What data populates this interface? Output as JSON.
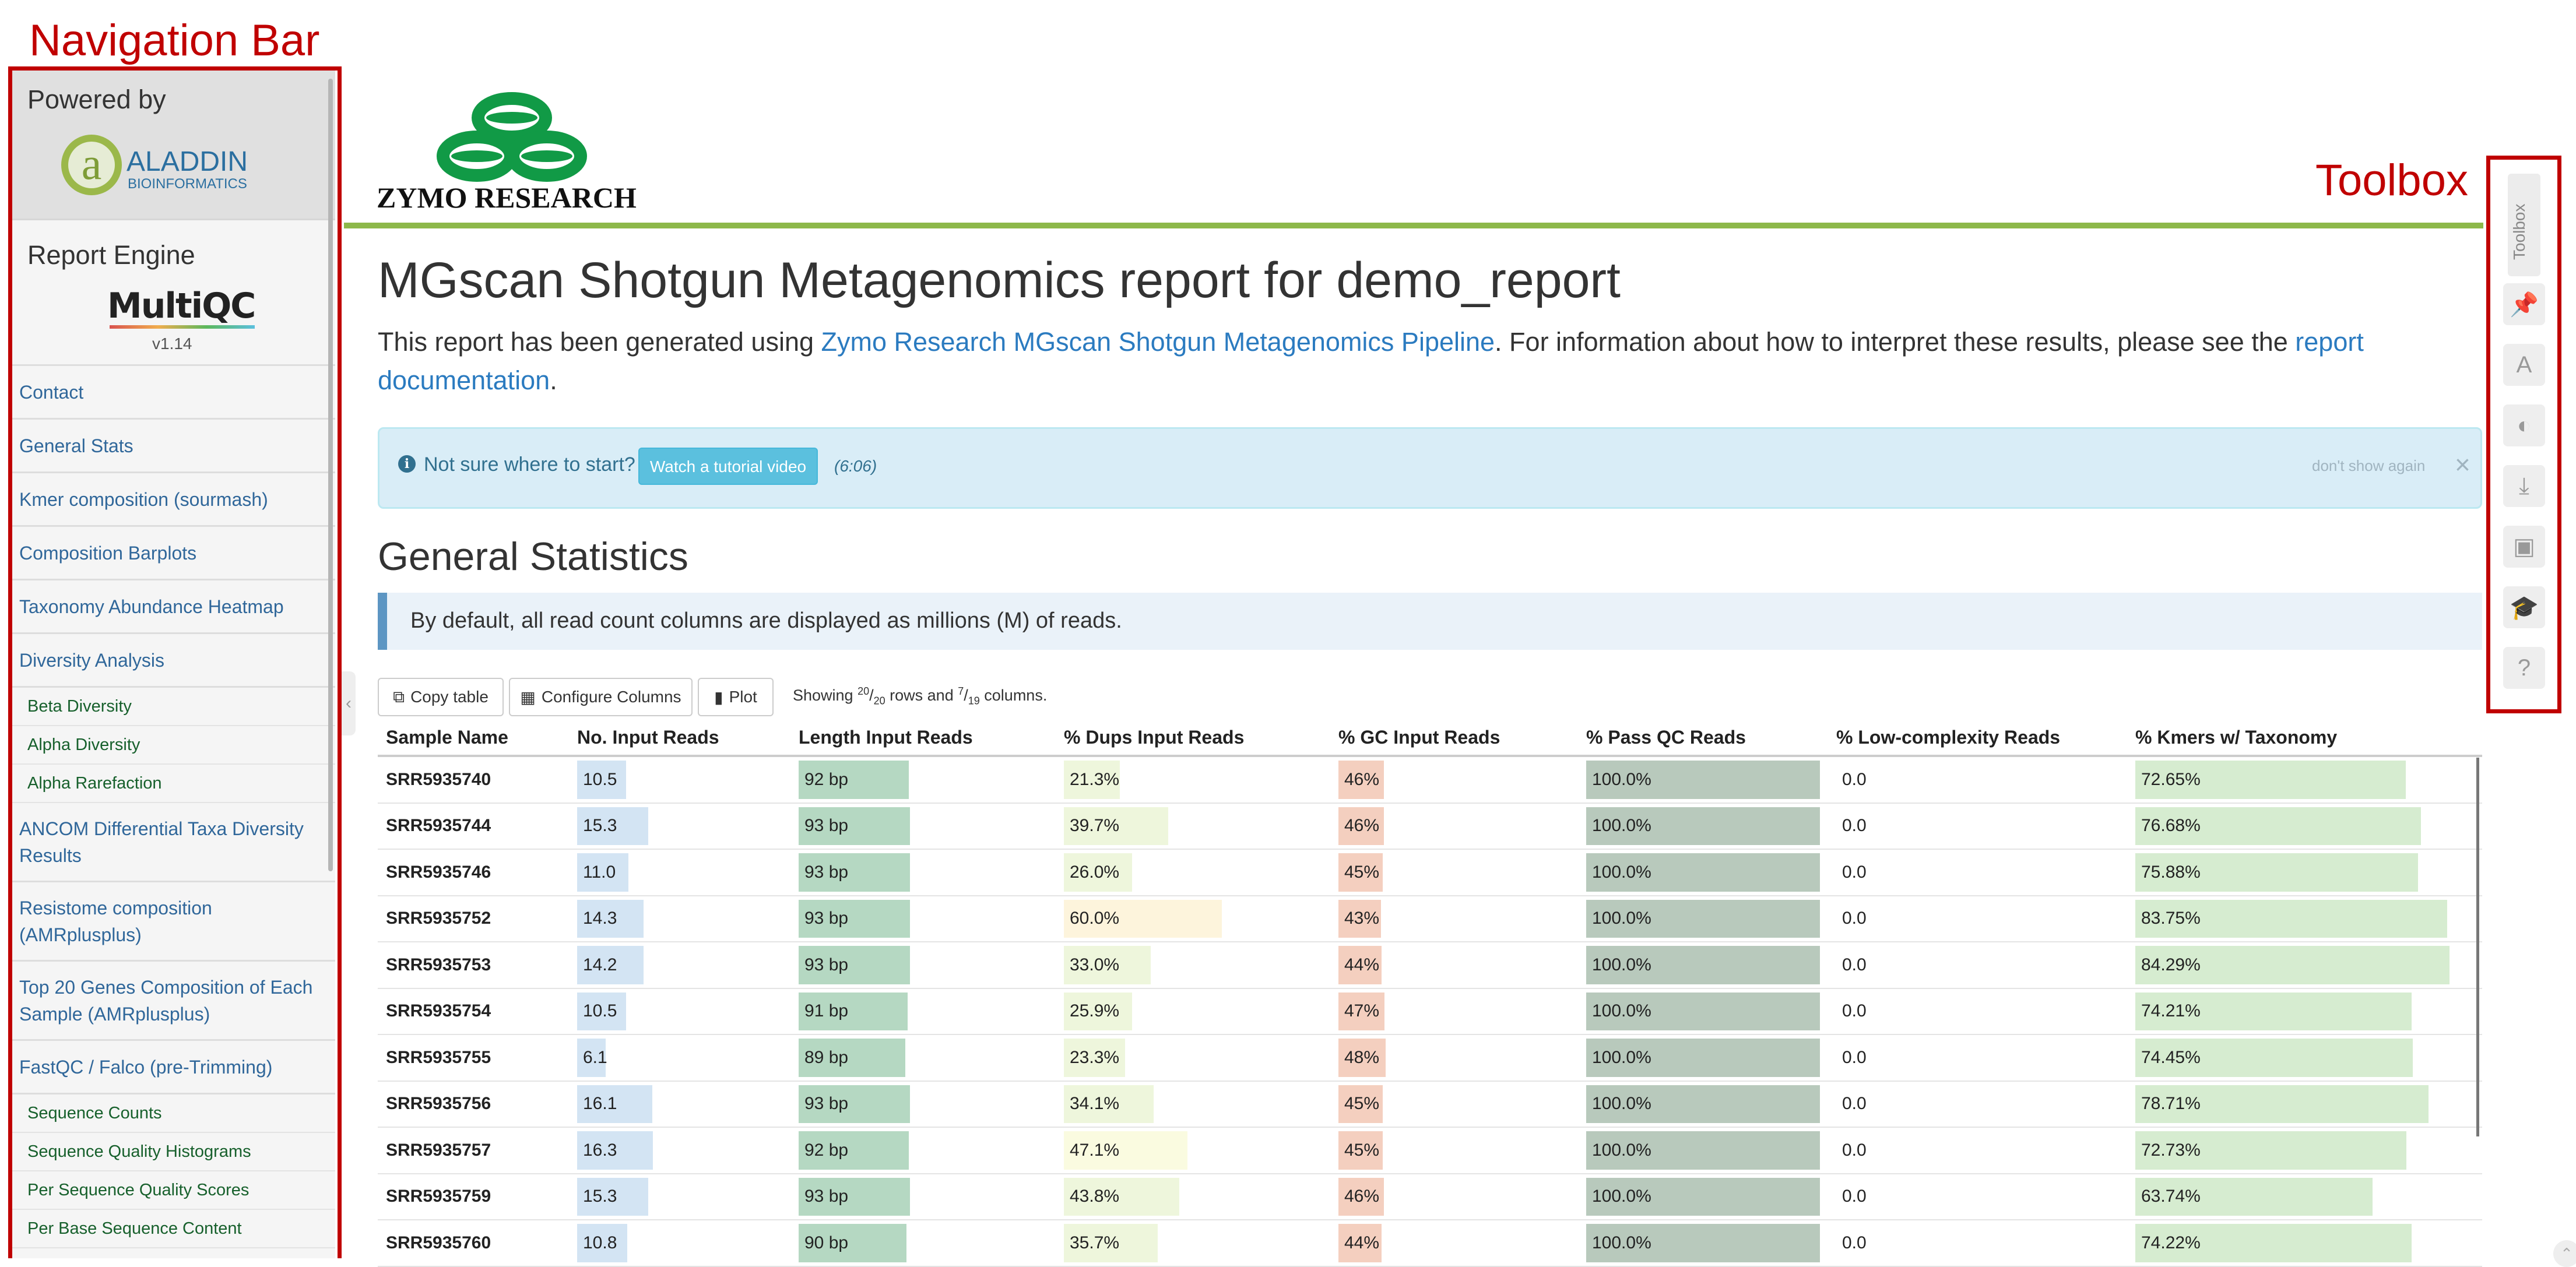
{
  "annotations": {
    "navigation_bar": "Navigation Bar",
    "toolbox": "Toolbox"
  },
  "sidebar": {
    "powered_by": "Powered by",
    "aladdin_name": "ALADDIN",
    "aladdin_sub": "BIOINFORMATICS",
    "report_engine": "Report Engine",
    "multiqc": "MultiQC",
    "version": "v1.14",
    "items": [
      {
        "label": "Contact",
        "type": "main"
      },
      {
        "label": "General Stats",
        "type": "main"
      },
      {
        "label": "Kmer composition (sourmash)",
        "type": "main"
      },
      {
        "label": "Composition Barplots",
        "type": "main"
      },
      {
        "label": "Taxonomy Abundance Heatmap",
        "type": "main"
      },
      {
        "label": "Diversity Analysis",
        "type": "main"
      },
      {
        "label": "Beta Diversity",
        "type": "sub"
      },
      {
        "label": "Alpha Diversity",
        "type": "sub"
      },
      {
        "label": "Alpha Rarefaction",
        "type": "sub"
      },
      {
        "label": "ANCOM Differential Taxa Diversity Results",
        "type": "main"
      },
      {
        "label": "Resistome composition (AMRplusplus)",
        "type": "main"
      },
      {
        "label": "Top 20 Genes Composition of Each Sample (AMRplusplus)",
        "type": "main"
      },
      {
        "label": "FastQC / Falco (pre-Trimming)",
        "type": "main"
      },
      {
        "label": "Sequence Counts",
        "type": "sub"
      },
      {
        "label": "Sequence Quality Histograms",
        "type": "sub"
      },
      {
        "label": "Per Sequence Quality Scores",
        "type": "sub"
      },
      {
        "label": "Per Base Sequence Content",
        "type": "sub"
      }
    ]
  },
  "header": {
    "logo_text": "ZYMO RESEARCH",
    "title": "MGscan Shotgun Metagenomics report for demo_report",
    "intro_prefix": "This report has been generated using ",
    "intro_link1": "Zymo Research MGscan Shotgun Metagenomics Pipeline",
    "intro_middle": ". For information about how to interpret these results, please see the ",
    "intro_link2": "report documentation",
    "intro_suffix": "."
  },
  "tutorial": {
    "icon": "info-circle-icon",
    "text": "Not sure where to start?",
    "button": "Watch a tutorial video",
    "duration": "(6:06)",
    "dont_show": "don't show again",
    "close": "×"
  },
  "general_stats": {
    "title": "General Statistics",
    "note": "By default, all read count columns are displayed as millions (M) of reads.",
    "toolbar": {
      "copy": "Copy table",
      "configure": "Configure Columns",
      "plot": "Plot",
      "showing_prefix": "Showing ",
      "rows_shown": "20",
      "rows_total": "20",
      "rows_word": " rows and ",
      "cols_shown": "7",
      "cols_total": "19",
      "cols_word": " columns."
    },
    "columns": [
      "Sample Name",
      "No. Input Reads",
      "Length Input Reads",
      "% Dups Input Reads",
      "% GC Input Reads",
      "% Pass QC Reads",
      "% Low-complexity Reads",
      "% Kmers w/ Taxonomy"
    ],
    "bar_colors": {
      "reads": "#d3e4f3",
      "length": "#b5d8c2",
      "dups": "#eef6dc",
      "gc": "#f4cfbf",
      "pass": "#b8c9bc",
      "kmers": "#d6ecd0"
    },
    "rows": [
      {
        "sample": "SRR5935740",
        "reads": "10.5",
        "reads_v": 10.5,
        "length": "92 bp",
        "length_v": 92,
        "dups": "21.3%",
        "dups_v": 21.3,
        "gc": "46%",
        "gc_v": 46,
        "pass": "100.0%",
        "lowc": "0.0",
        "kmers": "72.65%",
        "kmers_v": 72.65
      },
      {
        "sample": "SRR5935744",
        "reads": "15.3",
        "reads_v": 15.3,
        "length": "93 bp",
        "length_v": 93,
        "dups": "39.7%",
        "dups_v": 39.7,
        "gc": "46%",
        "gc_v": 46,
        "pass": "100.0%",
        "lowc": "0.0",
        "kmers": "76.68%",
        "kmers_v": 76.68
      },
      {
        "sample": "SRR5935746",
        "reads": "11.0",
        "reads_v": 11.0,
        "length": "93 bp",
        "length_v": 93,
        "dups": "26.0%",
        "dups_v": 26.0,
        "gc": "45%",
        "gc_v": 45,
        "pass": "100.0%",
        "lowc": "0.0",
        "kmers": "75.88%",
        "kmers_v": 75.88
      },
      {
        "sample": "SRR5935752",
        "reads": "14.3",
        "reads_v": 14.3,
        "length": "93 bp",
        "length_v": 93,
        "dups": "60.0%",
        "dups_v": 60.0,
        "gc": "43%",
        "gc_v": 43,
        "pass": "100.0%",
        "lowc": "0.0",
        "kmers": "83.75%",
        "kmers_v": 83.75
      },
      {
        "sample": "SRR5935753",
        "reads": "14.2",
        "reads_v": 14.2,
        "length": "93 bp",
        "length_v": 93,
        "dups": "33.0%",
        "dups_v": 33.0,
        "gc": "44%",
        "gc_v": 44,
        "pass": "100.0%",
        "lowc": "0.0",
        "kmers": "84.29%",
        "kmers_v": 84.29
      },
      {
        "sample": "SRR5935754",
        "reads": "10.5",
        "reads_v": 10.5,
        "length": "91 bp",
        "length_v": 91,
        "dups": "25.9%",
        "dups_v": 25.9,
        "gc": "47%",
        "gc_v": 47,
        "pass": "100.0%",
        "lowc": "0.0",
        "kmers": "74.21%",
        "kmers_v": 74.21
      },
      {
        "sample": "SRR5935755",
        "reads": "6.1",
        "reads_v": 6.1,
        "length": "89 bp",
        "length_v": 89,
        "dups": "23.3%",
        "dups_v": 23.3,
        "gc": "48%",
        "gc_v": 48,
        "pass": "100.0%",
        "lowc": "0.0",
        "kmers": "74.45%",
        "kmers_v": 74.45
      },
      {
        "sample": "SRR5935756",
        "reads": "16.1",
        "reads_v": 16.1,
        "length": "93 bp",
        "length_v": 93,
        "dups": "34.1%",
        "dups_v": 34.1,
        "gc": "45%",
        "gc_v": 45,
        "pass": "100.0%",
        "lowc": "0.0",
        "kmers": "78.71%",
        "kmers_v": 78.71
      },
      {
        "sample": "SRR5935757",
        "reads": "16.3",
        "reads_v": 16.3,
        "length": "92 bp",
        "length_v": 92,
        "dups": "47.1%",
        "dups_v": 47.1,
        "gc": "45%",
        "gc_v": 45,
        "pass": "100.0%",
        "lowc": "0.0",
        "kmers": "72.73%",
        "kmers_v": 72.73
      },
      {
        "sample": "SRR5935759",
        "reads": "15.3",
        "reads_v": 15.3,
        "length": "93 bp",
        "length_v": 93,
        "dups": "43.8%",
        "dups_v": 43.8,
        "gc": "46%",
        "gc_v": 46,
        "pass": "100.0%",
        "lowc": "0.0",
        "kmers": "63.74%",
        "kmers_v": 63.74
      },
      {
        "sample": "SRR5935760",
        "reads": "10.8",
        "reads_v": 10.8,
        "length": "90 bp",
        "length_v": 90,
        "dups": "35.7%",
        "dups_v": 35.7,
        "gc": "44%",
        "gc_v": 44,
        "pass": "100.0%",
        "lowc": "0.0",
        "kmers": "74.22%",
        "kmers_v": 74.22
      }
    ]
  },
  "toolbox": {
    "label": "Toolbox",
    "buttons": [
      {
        "icon": "pin-icon",
        "glyph": "📌"
      },
      {
        "icon": "font-icon",
        "glyph": "A"
      },
      {
        "icon": "eye-slash-icon",
        "glyph": "◐"
      },
      {
        "icon": "download-icon",
        "glyph": "⤓"
      },
      {
        "icon": "save-icon",
        "glyph": "▣"
      },
      {
        "icon": "graduation-cap-icon",
        "glyph": "🎓"
      },
      {
        "icon": "question-circle-icon",
        "glyph": "?"
      }
    ]
  }
}
